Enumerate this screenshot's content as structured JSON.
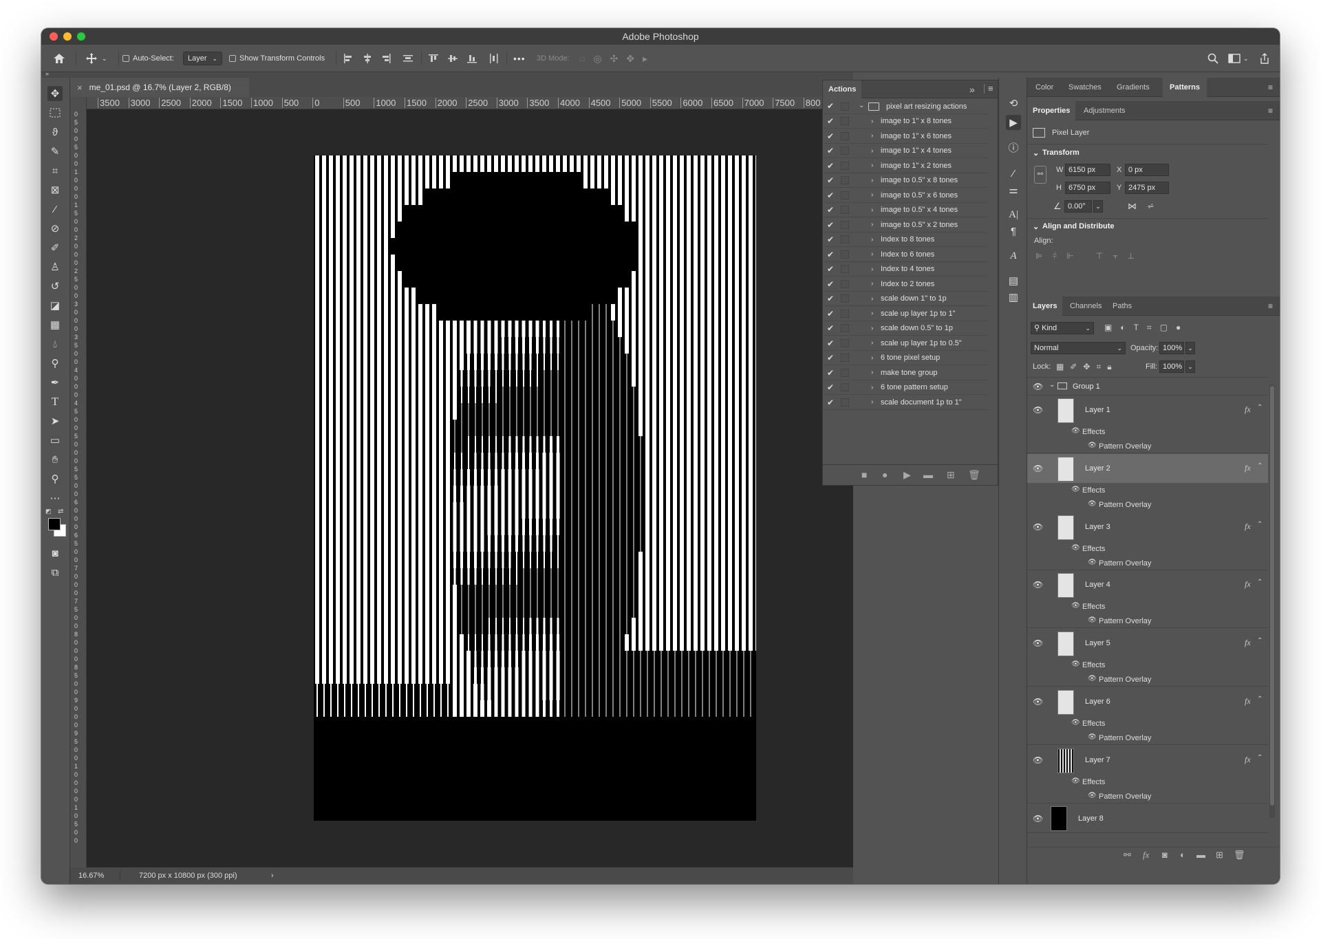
{
  "window": {
    "title": "Adobe Photoshop"
  },
  "options_bar": {
    "auto_select_label": "Auto-Select:",
    "auto_select_value": "Layer",
    "show_transform_label": "Show Transform Controls",
    "mode_3d_label": "3D Mode:",
    "more_label": "•••"
  },
  "document": {
    "tab_title": "me_01.psd @ 16.7% (Layer 2, RGB/8)",
    "close_glyph": "×",
    "zoom": "16.67%",
    "doc_info": "7200 px x 10800 px (300 ppi)",
    "status_arrow": "›"
  },
  "ruler": {
    "h_labels": [
      "3500",
      "3000",
      "2500",
      "2000",
      "1500",
      "1000",
      "500",
      "0",
      "500",
      "1000",
      "1500",
      "2000",
      "2500",
      "3000",
      "3500",
      "4000",
      "4500",
      "5000",
      "5500",
      "6000",
      "6500",
      "7000",
      "7500",
      "800"
    ],
    "v_labels": [
      "0",
      "5",
      "0",
      "0",
      "5",
      "0",
      "0",
      "1",
      "0",
      "0",
      "0",
      "1",
      "5",
      "0",
      "0",
      "2",
      "0",
      "0",
      "0",
      "2",
      "5",
      "0",
      "0",
      "3",
      "0",
      "0",
      "0",
      "3",
      "5",
      "0",
      "0",
      "4",
      "0",
      "0",
      "0",
      "4",
      "5",
      "0",
      "0",
      "5",
      "0",
      "0",
      "0",
      "5",
      "5",
      "0",
      "0",
      "6",
      "0",
      "0",
      "0",
      "6",
      "5",
      "0",
      "0",
      "7",
      "0",
      "0",
      "0",
      "7",
      "5",
      "0",
      "0",
      "8",
      "0",
      "0",
      "0",
      "8",
      "5",
      "0",
      "0",
      "9",
      "0",
      "0",
      "0",
      "9",
      "5",
      "0",
      "0",
      "1",
      "0",
      "0",
      "0",
      "0",
      "1",
      "0",
      "5",
      "0",
      "0"
    ]
  },
  "actions": {
    "tab": "Actions",
    "expand_glyph": "»",
    "menu_glyph": "≡",
    "set_name": "pixel art resizing actions",
    "items": [
      "image to 1\" x 8 tones",
      "image to 1\" x 6 tones",
      "image to 1\" x 4 tones",
      "image to 1\" x 2 tones",
      "image to 0.5\" x 8 tones",
      "image to 0.5\" x 6 tones",
      "image to 0.5\" x 4 tones",
      "image to 0.5\" x 2 tones",
      "Index to 8 tones",
      "Index to 6 tones",
      "Index to 4 tones",
      "Index to 2 tones",
      "scale down 1\" to 1p",
      "scale up layer 1p to 1\"",
      "scale down 0.5\" to 1p",
      "scale up layer 1p to 0.5\"",
      "6 tone pixel setup",
      "make tone group",
      "6 tone pattern setup",
      "scale document 1p to 1\""
    ]
  },
  "color_tabs": [
    "Color",
    "Swatches",
    "Gradients",
    "Patterns"
  ],
  "properties": {
    "tabs": [
      "Properties",
      "Adjustments"
    ],
    "layer_type": "Pixel Layer",
    "transform_label": "Transform",
    "w_label": "W",
    "w_value": "6150 px",
    "h_label": "H",
    "h_value": "6750 px",
    "x_label": "X",
    "x_value": "0 px",
    "y_label": "Y",
    "y_value": "2475 px",
    "angle_value": "0.00°",
    "align_label": "Align and Distribute",
    "align_sub": "Align:"
  },
  "layers": {
    "tabs": [
      "Layers",
      "Channels",
      "Paths"
    ],
    "kind_label": "Kind",
    "blend_mode": "Normal",
    "opacity_label": "Opacity:",
    "opacity_value": "100%",
    "lock_label": "Lock:",
    "fill_label": "Fill:",
    "fill_value": "100%",
    "group_name": "Group 1",
    "effects_label": "Effects",
    "overlay_label": "Pattern Overlay",
    "fx_glyph": "fx",
    "items": [
      "Layer 1",
      "Layer 2",
      "Layer 3",
      "Layer 4",
      "Layer 5",
      "Layer 6",
      "Layer 7"
    ],
    "bottom_layer": "Layer 8"
  },
  "colors": {
    "accent_selected_layer": "#6b6b6b",
    "traffic_red": "#ff5f57",
    "traffic_yellow": "#febc2e",
    "traffic_green": "#28c840"
  }
}
